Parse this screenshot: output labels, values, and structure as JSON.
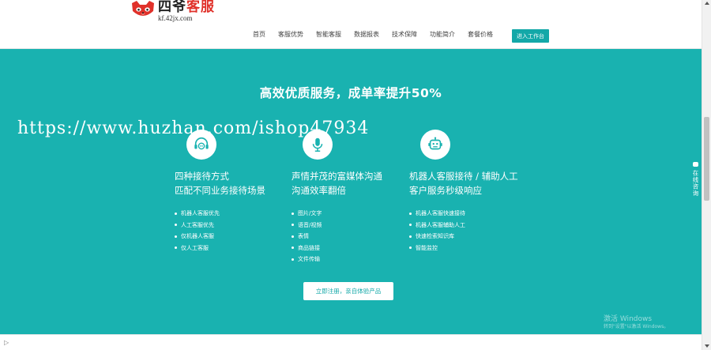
{
  "brand": {
    "title_main": "四爷",
    "title_accent": "客服",
    "domain": "kf.42jx.com"
  },
  "nav": {
    "items": [
      "首页",
      "客服优势",
      "智能客服",
      "数据报表",
      "技术保障",
      "功能简介",
      "套餐价格"
    ],
    "cta": "进入工作台"
  },
  "hero": {
    "title": "高效优质服务，成单率提升50%",
    "watermark": "https://www.huzhan.com/ishop47934",
    "features": [
      {
        "icon": "headset-chat-icon",
        "heading_line1": "四种接待方式",
        "heading_line2": "匹配不同业务接待场景",
        "items": [
          "机器人客服优先",
          "人工客服优先",
          "仅机器人客服",
          "仅人工客服"
        ]
      },
      {
        "icon": "microphone-icon",
        "heading_line1": "声情并茂的富媒体沟通",
        "heading_line2": "沟通效率翻倍",
        "items": [
          "图片/文字",
          "语音/视频",
          "表情",
          "商品链接",
          "文件传输"
        ]
      },
      {
        "icon": "robot-icon",
        "heading_line1": "机器人客服接待 / 辅助人工",
        "heading_line2": "客户服务秒级响应",
        "items": [
          "机器人客服快速接待",
          "机器人客服辅助人工",
          "快速检索知识库",
          "智能监控"
        ]
      }
    ],
    "cta": "立即注册，亲自体验产品"
  },
  "side_tab": {
    "label": "在线咨询"
  },
  "windows_watermark": {
    "line1": "激活 Windows",
    "line2": "转到\"设置\"以激活 Windows。"
  },
  "colors": {
    "teal": "#19b2b0",
    "teal_dark": "#13a8a8",
    "brand_red": "#e0312a"
  }
}
